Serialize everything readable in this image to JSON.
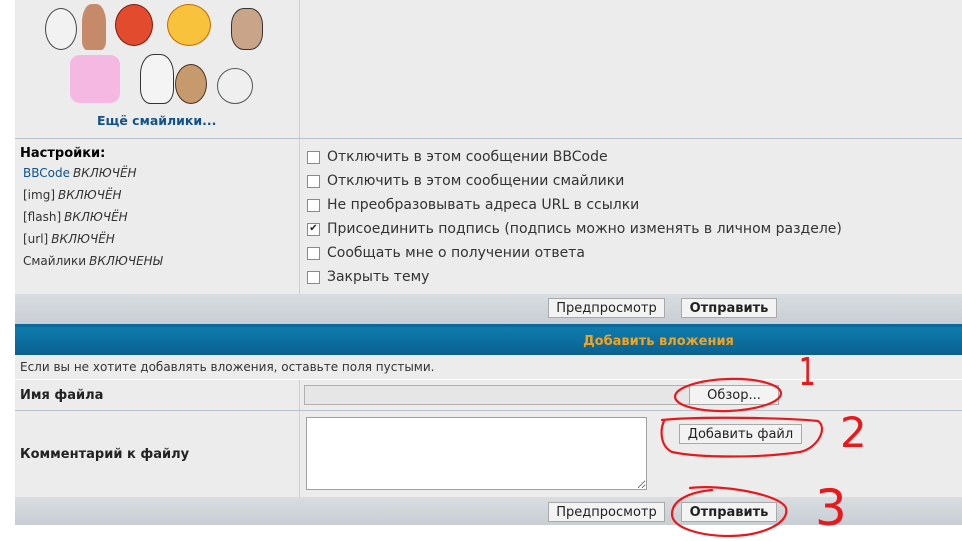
{
  "smilies": {
    "more_label": "Ещё смайлики..."
  },
  "settings": {
    "title": "Настройки:",
    "lines": [
      {
        "key": "BBCode",
        "value": "ВКЛЮЧЁН"
      },
      {
        "key": "[img]",
        "value": "ВКЛЮЧЁН"
      },
      {
        "key": "[flash]",
        "value": "ВКЛЮЧЁН"
      },
      {
        "key": "[url]",
        "value": "ВКЛЮЧЁН"
      },
      {
        "key": "Смайлики",
        "value": "ВКЛЮЧЕНЫ"
      }
    ],
    "options": [
      {
        "label": "Отключить в этом сообщении BBCode",
        "checked": false
      },
      {
        "label": "Отключить в этом сообщении смайлики",
        "checked": false
      },
      {
        "label": "Не преобразовывать адреса URL в ссылки",
        "checked": false
      },
      {
        "label": "Присоединить подпись (подпись можно изменять в личном разделе)",
        "checked": true
      },
      {
        "label": "Сообщать мне о получении ответа",
        "checked": false
      },
      {
        "label": "Закрыть тему",
        "checked": false
      }
    ]
  },
  "buttons": {
    "preview": "Предпросмотр",
    "submit": "Отправить",
    "browse": "Обзор...",
    "add_file": "Добавить файл"
  },
  "attachments": {
    "heading": "Добавить вложения",
    "hint": "Если вы не хотите добавлять вложения, оставьте поля пустыми.",
    "filename_label": "Имя файла",
    "comment_label": "Комментарий к файлу"
  },
  "annotations": [
    "1",
    "2",
    "3"
  ]
}
